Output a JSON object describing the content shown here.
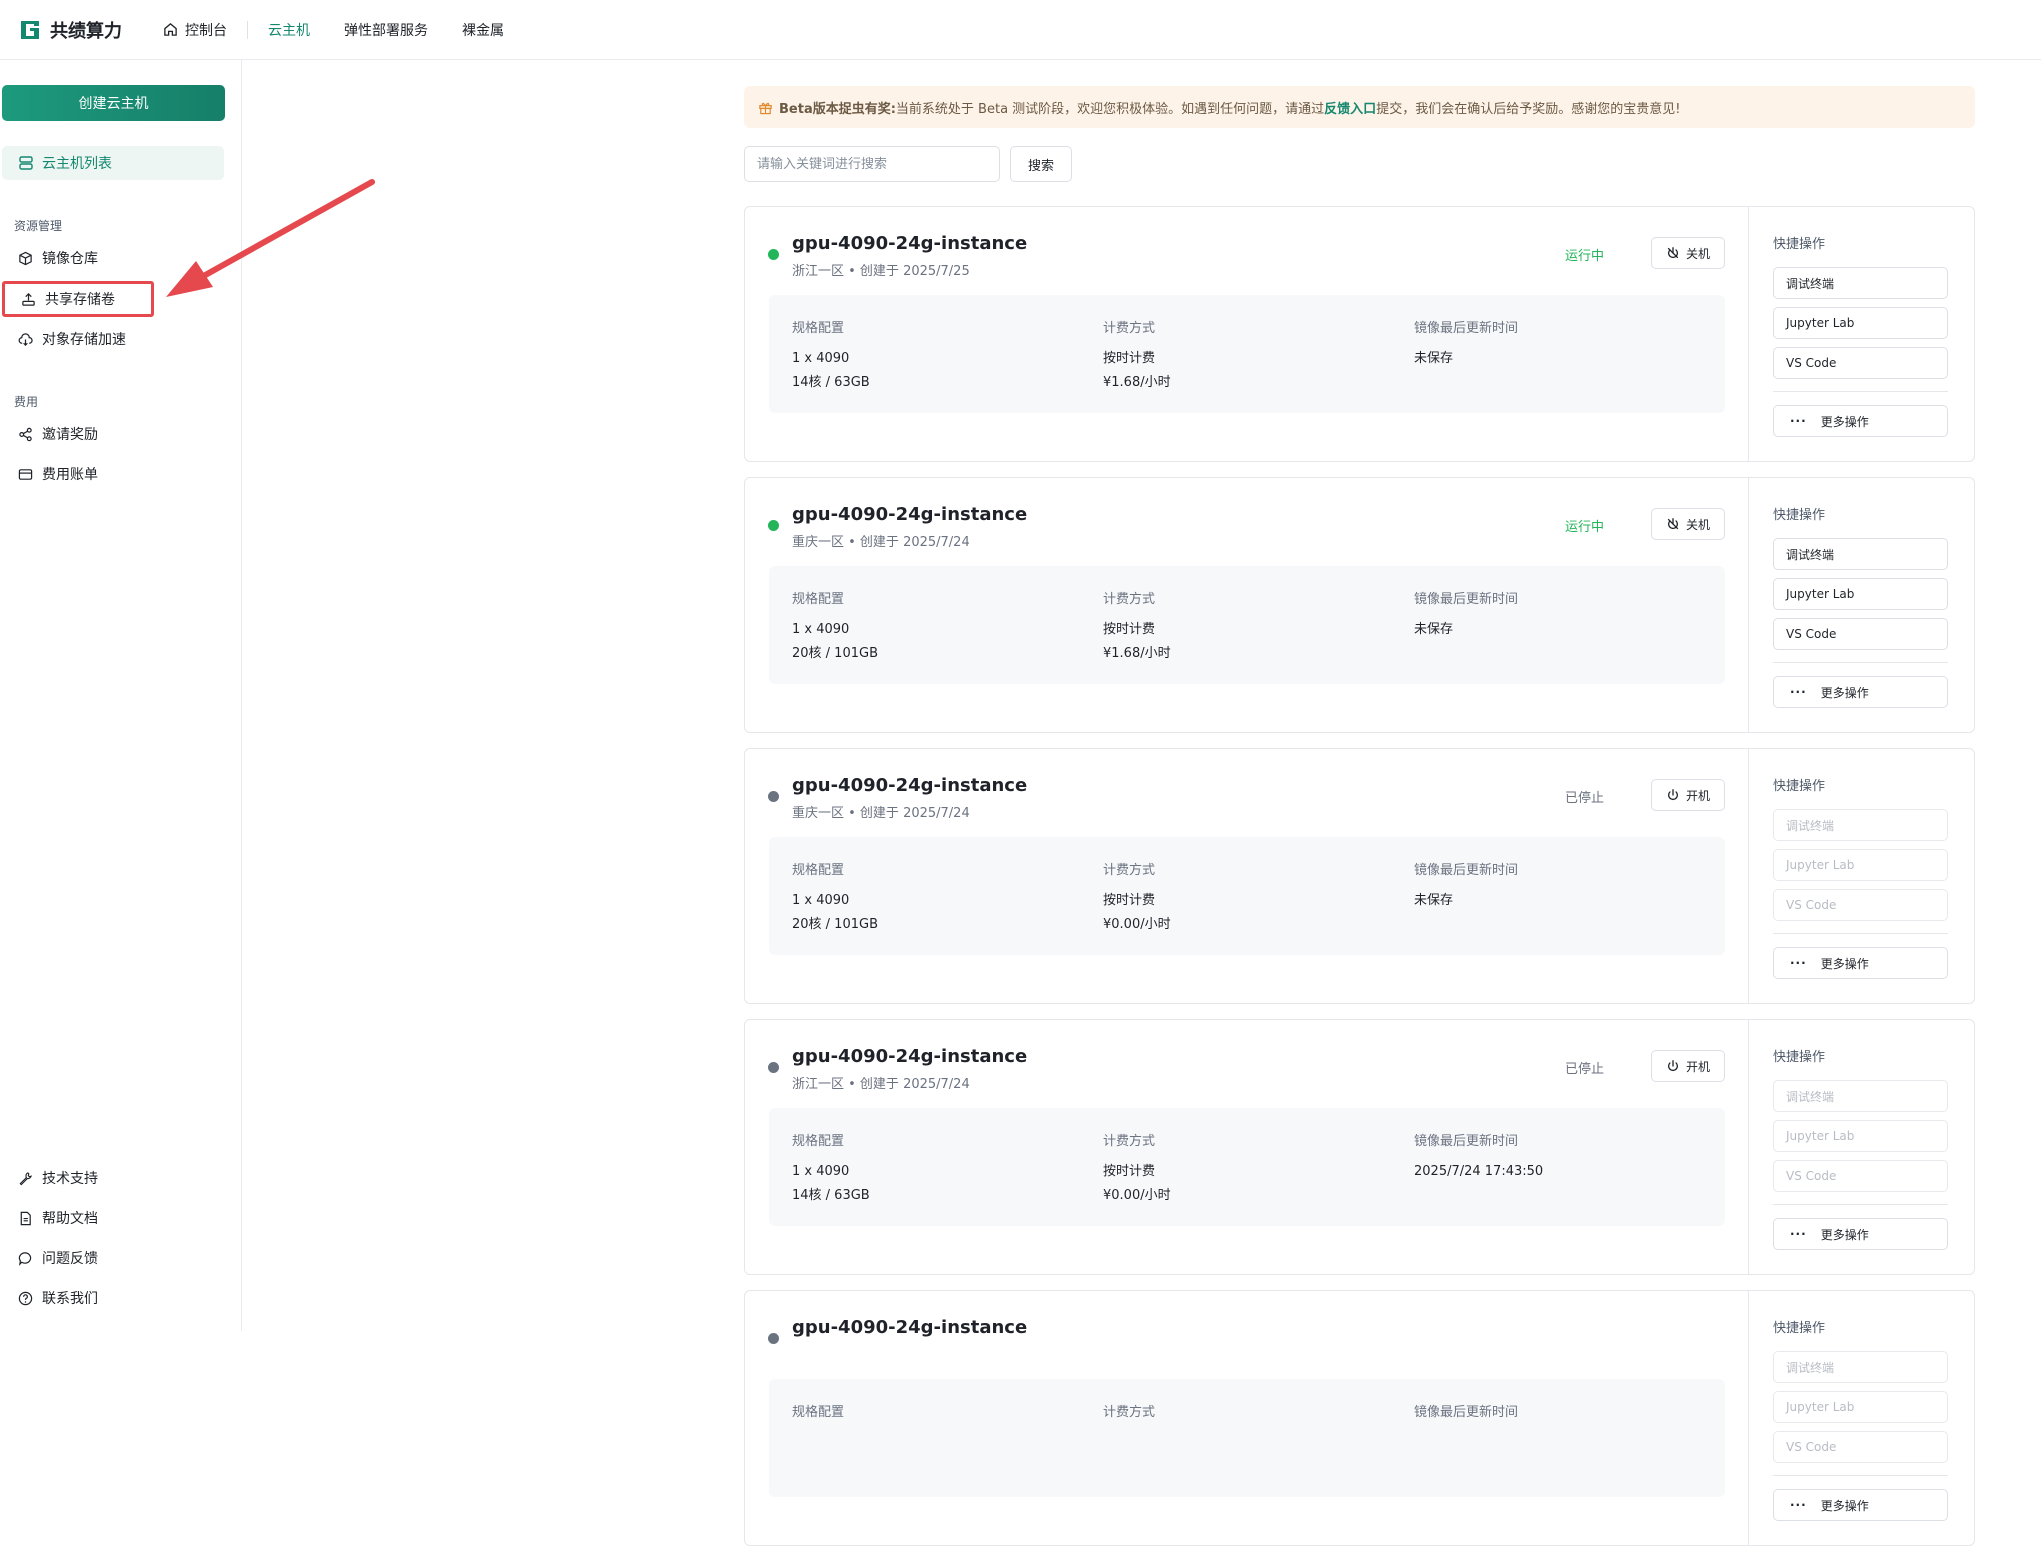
{
  "brand": {
    "name": "共绩算力",
    "color": "#14876f"
  },
  "nav": {
    "console": "控制台",
    "cloud_host": "云主机",
    "elastic": "弹性部署服务",
    "bare_metal": "裸金属"
  },
  "sidebar": {
    "create_button": "创建云主机",
    "vm_list": "云主机列表",
    "group_resources": "资源管理",
    "image_repo": "镜像仓库",
    "shared_storage": "共享存储卷",
    "object_storage": "对象存储加速",
    "group_billing": "费用",
    "invite": "邀请奖励",
    "bills": "费用账单",
    "tech_support": "技术支持",
    "help_docs": "帮助文档",
    "feedback": "问题反馈",
    "contact": "联系我们"
  },
  "beta": {
    "title": "Beta版本捉虫有奖:",
    "text_before": "当前系统处于 Beta 测试阶段，欢迎您积极体验。如遇到任何问题，请通过",
    "link": "反馈入口",
    "text_after": "提交，我们会在确认后给予奖励。感谢您的宝贵意见!"
  },
  "search": {
    "placeholder": "请输入关键词进行搜索",
    "button": "搜索"
  },
  "labels": {
    "spec": "规格配置",
    "billing": "计费方式",
    "image_updated": "镜像最后更新时间",
    "quick_ops": "快捷操作",
    "debug_terminal": "调试终端",
    "jupyter": "Jupyter Lab",
    "vscode": "VS Code",
    "more_ops": "更多操作"
  },
  "colors": {
    "running": "#22b55a",
    "stopped": "#6b7280",
    "arrow": "#e5484d"
  },
  "instances": [
    {
      "name": "gpu-4090-24g-instance",
      "sub": "浙江一区 • 创建于 2025/7/25",
      "status": "运行中",
      "running": true,
      "action": "关机",
      "gpu": "1 x 4090",
      "cpu_mem": "14核 / 63GB",
      "billing": "按时计费",
      "price": "¥1.68/小时",
      "image_time": "未保存"
    },
    {
      "name": "gpu-4090-24g-instance",
      "sub": "重庆一区 • 创建于 2025/7/24",
      "status": "运行中",
      "running": true,
      "action": "关机",
      "gpu": "1 x 4090",
      "cpu_mem": "20核 / 101GB",
      "billing": "按时计费",
      "price": "¥1.68/小时",
      "image_time": "未保存"
    },
    {
      "name": "gpu-4090-24g-instance",
      "sub": "重庆一区 • 创建于 2025/7/24",
      "status": "已停止",
      "running": false,
      "action": "开机",
      "gpu": "1 x 4090",
      "cpu_mem": "20核 / 101GB",
      "billing": "按时计费",
      "price": "¥0.00/小时",
      "image_time": "未保存"
    },
    {
      "name": "gpu-4090-24g-instance",
      "sub": "浙江一区 • 创建于 2025/7/24",
      "status": "已停止",
      "running": false,
      "action": "开机",
      "gpu": "1 x 4090",
      "cpu_mem": "14核 / 63GB",
      "billing": "按时计费",
      "price": "¥0.00/小时",
      "image_time": "2025/7/24 17:43:50"
    },
    {
      "name": "gpu-4090-24g-instance",
      "sub": "",
      "status": "",
      "running": false,
      "action": "",
      "gpu": "",
      "cpu_mem": "",
      "billing": "",
      "price": "",
      "image_time": ""
    }
  ]
}
